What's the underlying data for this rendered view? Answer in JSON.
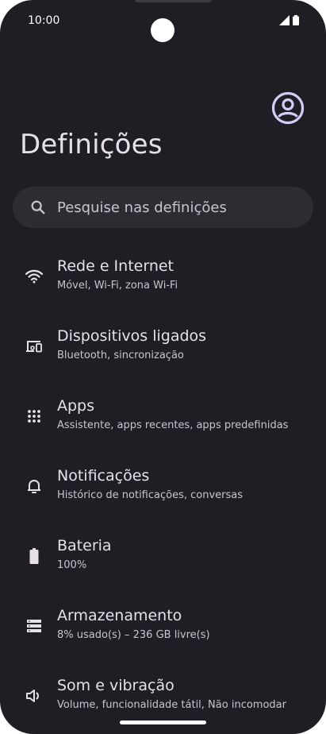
{
  "status": {
    "time": "10:00"
  },
  "header": {
    "title": "Definições"
  },
  "search": {
    "placeholder": "Pesquise nas definições"
  },
  "items": [
    {
      "title": "Rede e Internet",
      "subtitle": "Móvel, Wi-Fi, zona Wi-Fi",
      "icon": "wifi-icon"
    },
    {
      "title": "Dispositivos ligados",
      "subtitle": "Bluetooth, sincronização",
      "icon": "devices-icon"
    },
    {
      "title": "Apps",
      "subtitle": "Assistente, apps recentes, apps predefinidas",
      "icon": "apps-grid-icon"
    },
    {
      "title": "Notificações",
      "subtitle": "Histórico de notificações, conversas",
      "icon": "bell-icon"
    },
    {
      "title": "Bateria",
      "subtitle": "100%",
      "icon": "battery-icon"
    },
    {
      "title": "Armazenamento",
      "subtitle": "8% usado(s) – 236 GB livre(s)",
      "icon": "storage-icon"
    },
    {
      "title": "Som e vibração",
      "subtitle": "Volume, funcionalidade tátil, Não incomodar",
      "icon": "volume-icon"
    }
  ],
  "colors": {
    "background": "#1f1e25",
    "search_bg": "#2d2c33",
    "avatar": "#d3cef7"
  }
}
